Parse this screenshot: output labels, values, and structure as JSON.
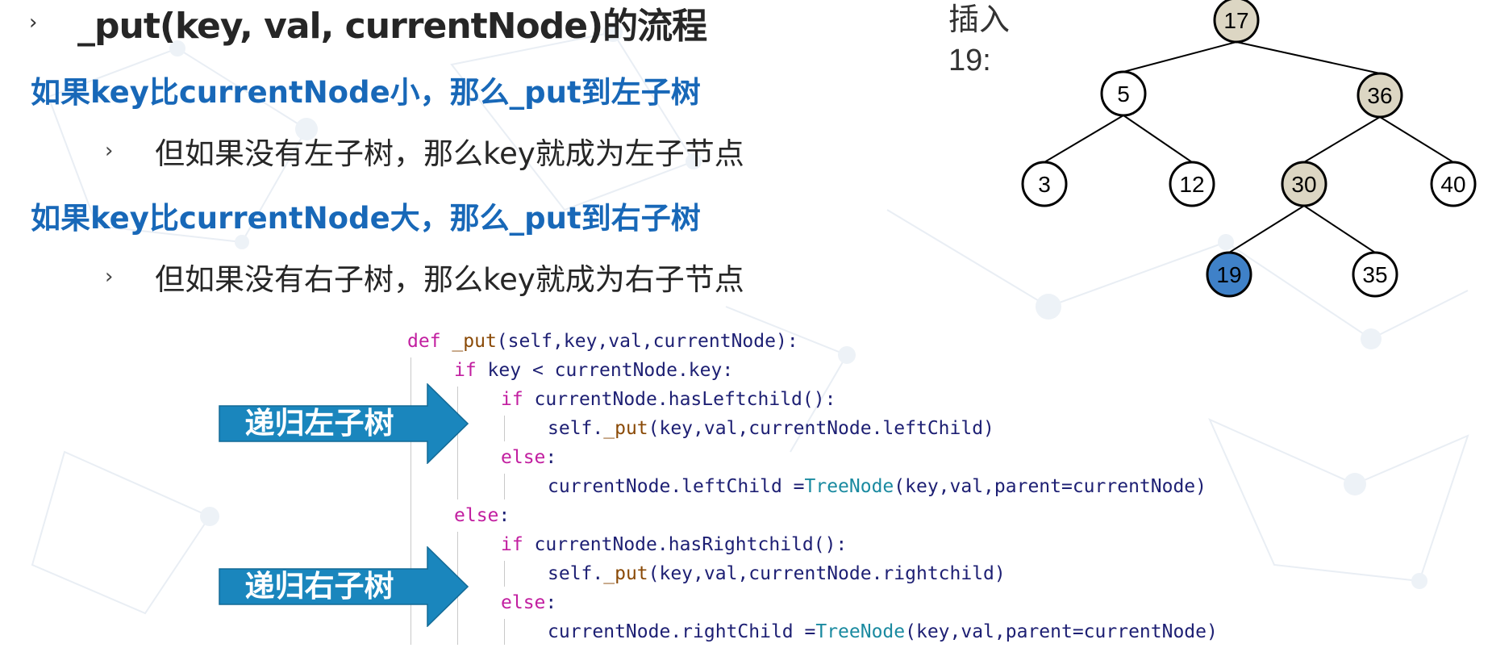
{
  "heading": {
    "chevron": "›",
    "title": "_put(key, val, currentNode)的流程"
  },
  "rules": [
    {
      "text": "如果key比currentNode小，那么_put到左子树",
      "sub_chevron": "›",
      "sub_text": "但如果没有左子树，那么key就成为左子节点"
    },
    {
      "text": "如果key比currentNode大，那么_put到右子树",
      "sub_chevron": "›",
      "sub_text": "但如果没有右子树，那么key就成为右子节点"
    }
  ],
  "insert_label": "插入19:",
  "tree": {
    "nodes": [
      {
        "id": "17",
        "label": "17",
        "state": "visited"
      },
      {
        "id": "5",
        "label": "5",
        "state": "normal"
      },
      {
        "id": "36",
        "label": "36",
        "state": "visited"
      },
      {
        "id": "3",
        "label": "3",
        "state": "normal"
      },
      {
        "id": "12",
        "label": "12",
        "state": "normal"
      },
      {
        "id": "30",
        "label": "30",
        "state": "visited"
      },
      {
        "id": "40",
        "label": "40",
        "state": "normal"
      },
      {
        "id": "19",
        "label": "19",
        "state": "inserted"
      },
      {
        "id": "35",
        "label": "35",
        "state": "normal"
      }
    ],
    "edges": [
      [
        "17",
        "5"
      ],
      [
        "17",
        "36"
      ],
      [
        "5",
        "3"
      ],
      [
        "5",
        "12"
      ],
      [
        "36",
        "30"
      ],
      [
        "36",
        "40"
      ],
      [
        "30",
        "19"
      ],
      [
        "30",
        "35"
      ]
    ],
    "colors": {
      "normal": "#ffffff",
      "visited": "#dcd6c3",
      "inserted": "#3f81c8",
      "stroke": "#000000"
    }
  },
  "code": {
    "lines": [
      {
        "indent": 0,
        "parts": [
          {
            "t": "def",
            "c": "kw"
          },
          {
            "t": " "
          },
          {
            "t": "_put",
            "c": "fn"
          },
          {
            "t": "(self,key,val,currentNode):"
          }
        ]
      },
      {
        "indent": 1,
        "parts": [
          {
            "t": "if",
            "c": "kw"
          },
          {
            "t": " key < currentNode.key:"
          }
        ]
      },
      {
        "indent": 2,
        "parts": [
          {
            "t": "if",
            "c": "kw"
          },
          {
            "t": " currentNode.hasLeftchild():"
          }
        ]
      },
      {
        "indent": 3,
        "parts": [
          {
            "t": "self."
          },
          {
            "t": "_put",
            "c": "fn"
          },
          {
            "t": "(key,val,currentNode.leftChild)"
          }
        ]
      },
      {
        "indent": 2,
        "parts": [
          {
            "t": "else",
            "c": "kw"
          },
          {
            "t": ":"
          }
        ]
      },
      {
        "indent": 3,
        "parts": [
          {
            "t": "currentNode.leftChild ="
          },
          {
            "t": "TreeNode",
            "c": "cls"
          },
          {
            "t": "(key,val,parent=currentNode)"
          }
        ]
      },
      {
        "indent": 1,
        "parts": [
          {
            "t": "else",
            "c": "kw"
          },
          {
            "t": ":"
          }
        ]
      },
      {
        "indent": 2,
        "parts": [
          {
            "t": "if",
            "c": "kw"
          },
          {
            "t": " currentNode.hasRightchild():"
          }
        ]
      },
      {
        "indent": 3,
        "parts": [
          {
            "t": "self."
          },
          {
            "t": "_put",
            "c": "fn"
          },
          {
            "t": "(key,val,currentNode.rightchild)"
          }
        ]
      },
      {
        "indent": 2,
        "parts": [
          {
            "t": "else",
            "c": "kw"
          },
          {
            "t": ":"
          }
        ]
      },
      {
        "indent": 3,
        "parts": [
          {
            "t": "currentNode.rightChild ="
          },
          {
            "t": "TreeNode",
            "c": "cls"
          },
          {
            "t": "(key,val,parent=currentNode)"
          }
        ]
      }
    ]
  },
  "arrows": {
    "left_label": "递归左子树",
    "right_label": "递归右子树",
    "fill": "#1a86bd",
    "stroke": "#136a96"
  }
}
